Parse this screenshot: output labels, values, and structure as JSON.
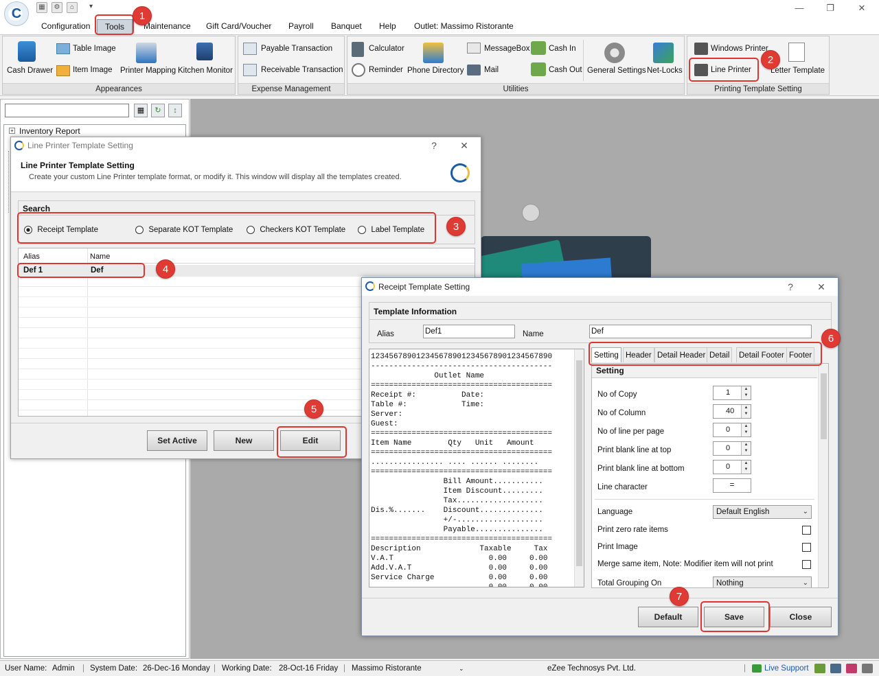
{
  "menu": {
    "tabs": [
      "Configuration",
      "Tools",
      "Maintenance",
      "Gift Card/Voucher",
      "Payroll",
      "Banquet",
      "Help",
      "Outlet: Massimo Ristorante"
    ]
  },
  "ribbon": {
    "groups": {
      "appearances": "Appearances",
      "expense": "Expense Management",
      "utilities": "Utilities",
      "printing": "Printing Template Setting"
    },
    "buttons": {
      "cash_drawer": "Cash Drawer",
      "table_image": "Table Image",
      "item_image": "Item Image",
      "printer_mapping": "Printer Mapping",
      "kitchen_monitor": "Kitchen Monitor",
      "payable": "Payable Transaction",
      "receivable": "Receivable Transaction",
      "calculator": "Calculator",
      "reminder": "Reminder",
      "phone_directory": "Phone Directory",
      "messagebox": "MessageBox",
      "mail": "Mail",
      "cash_in": "Cash In",
      "cash_out": "Cash Out",
      "general_settings": "General Settings",
      "net_locks": "Net-Locks",
      "windows_printer": "Windows Printer",
      "line_printer": "Line Printer",
      "letter_template": "Letter Template"
    }
  },
  "left_panel": {
    "tree_first": "Inventory Report"
  },
  "dialog1": {
    "window_title": "Line Printer Template Setting",
    "help": "?",
    "close": "✕",
    "heading": "Line Printer Template Setting",
    "description": "Create your custom Line Printer template format, or modify it. This window will display all the templates created.",
    "search_label": "Search",
    "radios": [
      "Receipt Template",
      "Separate KOT Template",
      "Checkers KOT Template",
      "Label Template"
    ],
    "grid": {
      "col_alias": "Alias",
      "col_name": "Name",
      "row_alias": "Def 1",
      "row_name": "Def"
    },
    "buttons": {
      "set_active": "Set Active",
      "new": "New",
      "edit": "Edit"
    }
  },
  "dialog2": {
    "window_title": "Receipt Template Setting",
    "help": "?",
    "close": "✕",
    "section_title": "Template Information",
    "alias_label": "Alias",
    "alias_value": "Def1",
    "name_label": "Name",
    "name_value": "Def",
    "preview": "1234567890123456789012345678901234567890\n----------------------------------------\n              Outlet Name\n========================================\nReceipt #:          Date:\nTable #:            Time:\nServer:\nGuest:\n========================================\nItem Name        Qty   Unit   Amount\n========================================\n................ .... ...... ........\n========================================\n                Bill Amount...........\n                Item Discount.........\n                Tax...................\nDis.%.......    Discount..............\n                +/-...................\n                Payable...............\n========================================\nDescription             Taxable     Tax\nV.A.T                     0.00     0.00\nAdd.V.A.T                 0.00     0.00\nService Charge            0.00     0.00\n                          0.00     0.00",
    "tabs": [
      "Setting",
      "Header",
      "Detail Header",
      "Detail",
      "Detail Footer",
      "Footer"
    ],
    "setting_title": "Setting",
    "fields": {
      "no_of_copy": {
        "label": "No of Copy",
        "value": "1"
      },
      "no_of_column": {
        "label": "No of Column",
        "value": "40"
      },
      "lines_per_page": {
        "label": "No of line per page",
        "value": "0"
      },
      "blank_top": {
        "label": "Print blank line at top",
        "value": "0"
      },
      "blank_bottom": {
        "label": "Print blank line at bottom",
        "value": "0"
      },
      "line_char": {
        "label": "Line character",
        "value": "="
      },
      "language": {
        "label": "Language",
        "value": "Default English"
      },
      "zero_rate": {
        "label": "Print zero rate items"
      },
      "print_image": {
        "label": "Print Image"
      },
      "merge_same": {
        "label": "Merge same item,  Note: Modifier item will not print"
      },
      "total_grouping": {
        "label": "Total Grouping On",
        "value": "Nothing"
      }
    },
    "buttons": {
      "default": "Default",
      "save": "Save",
      "close": "Close"
    }
  },
  "callouts": [
    "1",
    "2",
    "3",
    "4",
    "5",
    "6",
    "7"
  ],
  "status": {
    "user_label": "User Name:",
    "user": "Admin",
    "sysdate_label": "System Date:",
    "sysdate": "26-Dec-16 Monday",
    "workdate_label": "Working Date:",
    "workdate": "28-Oct-16 Friday",
    "outlet": "Massimo Ristorante",
    "company": "eZee Technosys Pvt. Ltd.",
    "support": "Live Support"
  },
  "colors": {
    "callout": "#e03a34",
    "accent": "#1b5aa6"
  }
}
